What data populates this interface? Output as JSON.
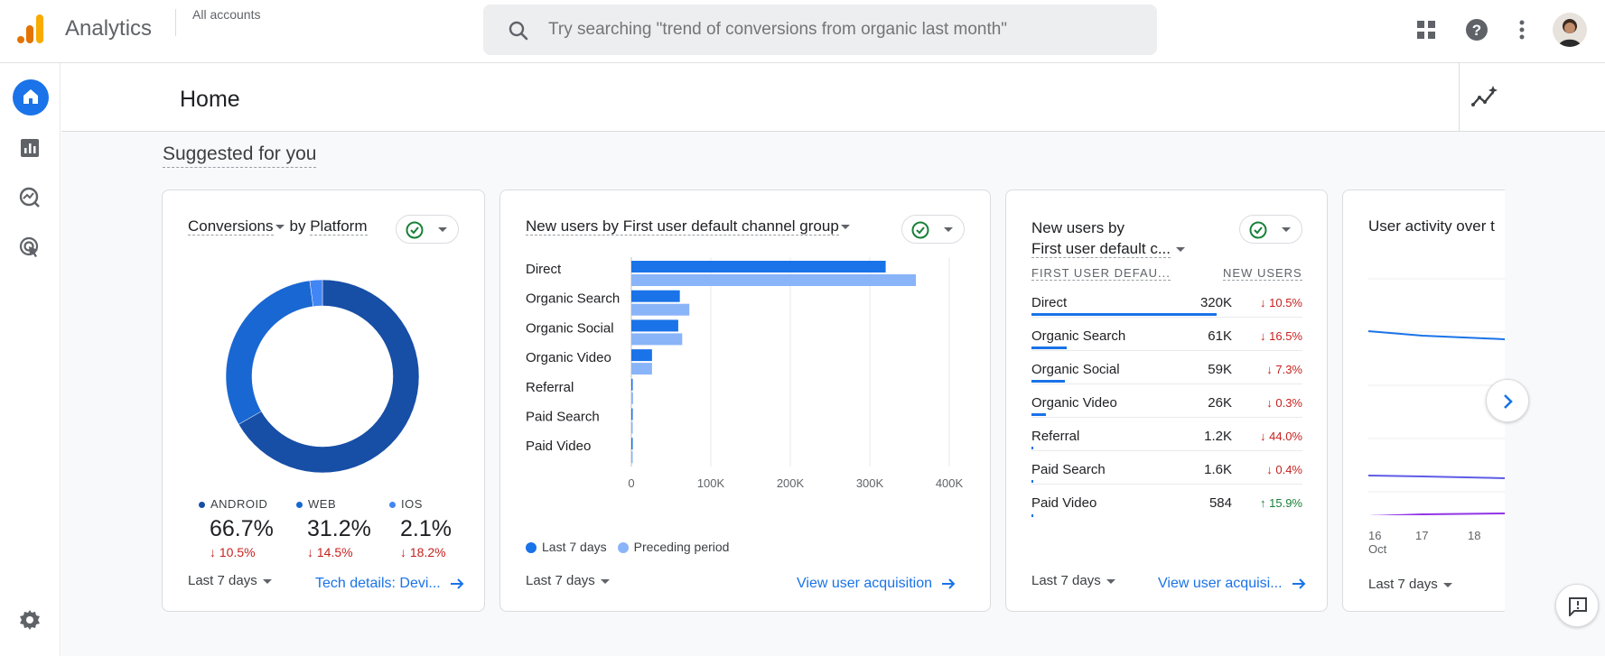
{
  "app": {
    "title": "Analytics",
    "accounts_label": "All accounts"
  },
  "search": {
    "placeholder": "Try searching \"trend of conversions from organic last month\""
  },
  "page": {
    "title": "Home",
    "section_title": "Suggested for you"
  },
  "icons": {
    "brand_colors": [
      "#f9ab00",
      "#e37400"
    ],
    "accent": "#1a73e8"
  },
  "card_conversions": {
    "title_metric": "Conversions",
    "title_by": "by",
    "title_dimension": "Platform",
    "legend": [
      {
        "label": "ANDROID",
        "value": "66.7%",
        "change": "10.5%",
        "direction": "down",
        "color": "#174ea6"
      },
      {
        "label": "WEB",
        "value": "31.2%",
        "change": "14.5%",
        "direction": "down",
        "color": "#1967d2"
      },
      {
        "label": "IOS",
        "value": "2.1%",
        "change": "18.2%",
        "direction": "down",
        "color": "#4285f4"
      }
    ],
    "date_range": "Last 7 days",
    "link": "Tech details: Devi..."
  },
  "card_new_users_chart": {
    "title": "New users by First user default channel group",
    "date_range": "Last 7 days",
    "link": "View user acquisition",
    "legend": [
      {
        "label": "Last 7 days",
        "color": "#1a73e8"
      },
      {
        "label": "Preceding period",
        "color": "#8ab4f8"
      }
    ]
  },
  "chart_data": {
    "type": "bar",
    "orientation": "horizontal",
    "title": "New users by First user default channel group",
    "categories": [
      "Direct",
      "Organic Search",
      "Organic Social",
      "Organic Video",
      "Referral",
      "Paid Search",
      "Paid Video"
    ],
    "series": [
      {
        "name": "Last 7 days",
        "values": [
          320000,
          61000,
          59000,
          26000,
          1200,
          1600,
          584
        ],
        "color": "#1a73e8"
      },
      {
        "name": "Preceding period",
        "values": [
          358000,
          73000,
          64000,
          26000,
          2100,
          1600,
          500
        ],
        "color": "#8ab4f8"
      }
    ],
    "xlim": [
      0,
      400000
    ],
    "xticks": [
      "0",
      "100K",
      "200K",
      "300K",
      "400K"
    ],
    "grid": true,
    "legend_position": "bottom-left"
  },
  "card_new_users_table": {
    "title_line1": "New users by",
    "title_line2": "First user default c...",
    "col1": "FIRST USER DEFAU...",
    "col2": "NEW USERS",
    "rows": [
      {
        "label": "Direct",
        "value": "320K",
        "change": "10.5%",
        "direction": "down",
        "share": 1.0
      },
      {
        "label": "Organic Search",
        "value": "61K",
        "change": "16.5%",
        "direction": "down",
        "share": 0.19
      },
      {
        "label": "Organic Social",
        "value": "59K",
        "change": "7.3%",
        "direction": "down",
        "share": 0.18
      },
      {
        "label": "Organic Video",
        "value": "26K",
        "change": "0.3%",
        "direction": "down",
        "share": 0.08
      },
      {
        "label": "Referral",
        "value": "1.2K",
        "change": "44.0%",
        "direction": "down",
        "share": 0.004
      },
      {
        "label": "Paid Search",
        "value": "1.6K",
        "change": "0.4%",
        "direction": "down",
        "share": 0.005
      },
      {
        "label": "Paid Video",
        "value": "584",
        "change": "15.9%",
        "direction": "up",
        "share": 0.002
      }
    ],
    "date_range": "Last 7 days",
    "link": "View user acquisi..."
  },
  "card_user_activity": {
    "title": "User activity over t",
    "x_ticks": [
      "16",
      "17",
      "18"
    ],
    "x_month": "Oct",
    "date_range": "Last 7 days",
    "line_colors": [
      "#1a73e8",
      "#5e5ce6",
      "#9334e6"
    ]
  }
}
